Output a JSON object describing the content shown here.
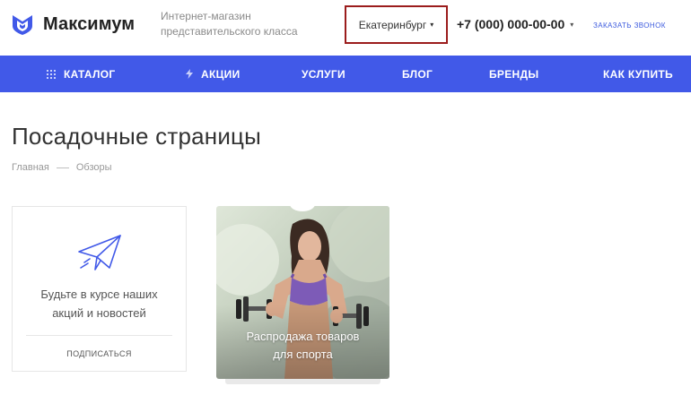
{
  "header": {
    "logo_text": "Максимум",
    "tagline": "Интернет-магазин представительского класса",
    "city": "Екатеринбург",
    "phone": "+7 (000) 000-00-00",
    "callback_label": "Заказать звонок"
  },
  "nav": {
    "items": [
      {
        "label": "КАТАЛОГ",
        "icon": "grid-icon"
      },
      {
        "label": "АКЦИИ",
        "icon": "lightning-icon"
      },
      {
        "label": "УСЛУГИ"
      },
      {
        "label": "БЛОГ"
      },
      {
        "label": "БРЕНДЫ"
      },
      {
        "label": "КАК КУПИТЬ"
      }
    ]
  },
  "page": {
    "title": "Посадочные страницы",
    "breadcrumb": [
      "Главная",
      "Обзоры"
    ]
  },
  "subscribe": {
    "icon": "paper-plane-icon",
    "text_line1": "Будьте в курсе наших",
    "text_line2": "акций и новостей",
    "button_label": "ПОДПИСАТЬСЯ"
  },
  "promo": {
    "caption_line1": "Распродажа товаров",
    "caption_line2": "для спорта"
  },
  "colors": {
    "accent": "#4159e8",
    "highlight_border": "#9b1c1c",
    "link": "#3d5bde"
  }
}
